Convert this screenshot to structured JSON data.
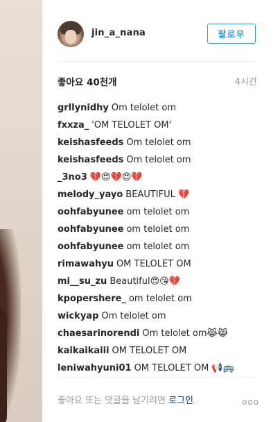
{
  "post": {
    "username": "jin_a_nana",
    "follow_label": "팔로우",
    "likes_text": "좋아요 40천개",
    "time_text": "4시간"
  },
  "comments": [
    {
      "user": "grllynidhy",
      "text": "Om telolet om"
    },
    {
      "user": "fxxza_",
      "text": "'OM TELOLET OM'"
    },
    {
      "user": "keishasfeeds",
      "text": "Om telolet om"
    },
    {
      "user": "keishasfeeds",
      "text": "Om telolet om"
    },
    {
      "user": "_3no3",
      "text": "💔😍💔😍💔"
    },
    {
      "user": "melody_yayo",
      "text": "BEAUTIFUL 💔"
    },
    {
      "user": "oohfabyunee",
      "text": "om telolet om"
    },
    {
      "user": "oohfabyunee",
      "text": "om telolet om"
    },
    {
      "user": "oohfabyunee",
      "text": "om telolet om"
    },
    {
      "user": "rimawahyu",
      "text": "OM TELOLET OM"
    },
    {
      "user": "mi__su_zu",
      "text": "Beautiful😍😘💔"
    },
    {
      "user": "kpopershere_",
      "text": "om telolet om"
    },
    {
      "user": "wickyap",
      "text": "Om telolet om"
    },
    {
      "user": "chaesarinorendi",
      "text": "Om telolet om😹😹"
    },
    {
      "user": "kaikaikaiii",
      "text": "OM TELOLET OM"
    },
    {
      "user": "leniwahyuni01",
      "text": "OM TELOLET OM 📢🚌"
    }
  ],
  "footer": {
    "prompt_text": "좋아요 또는 댓글을 남기려면 ",
    "login_label": "로그인",
    "suffix": ".",
    "more_icon": "ooo"
  },
  "icons": {
    "more": "more-options-icon"
  },
  "colors": {
    "accent": "#3897f0",
    "muted": "#999999",
    "link": "#003569"
  }
}
